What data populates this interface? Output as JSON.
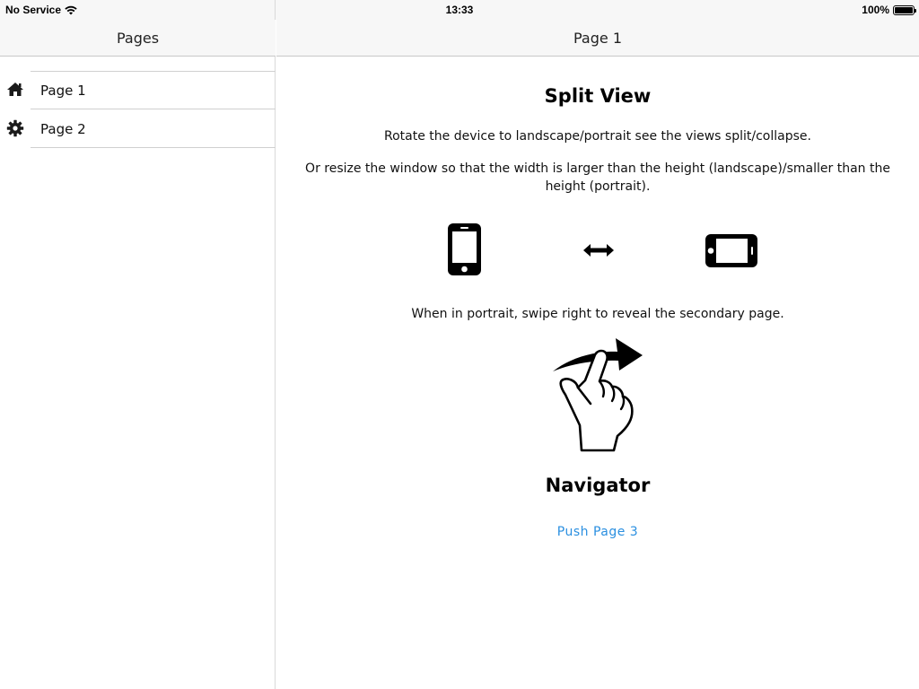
{
  "status_bar": {
    "carrier": "No Service",
    "time": "13:33",
    "battery": "100%",
    "battery_level": 1.0
  },
  "sidebar": {
    "title": "Pages",
    "items": [
      {
        "label": "Page 1",
        "icon": "home-icon"
      },
      {
        "label": "Page 2",
        "icon": "gear-icon"
      }
    ]
  },
  "main": {
    "title": "Page 1",
    "heading": "Split View",
    "paragraph_1": "Rotate the device to landscape/portrait see the views split/collapse.",
    "paragraph_2": "Or resize the window so that the width is larger than the height (landscape)/smaller than the height (portrait).",
    "paragraph_3": "When in portrait, swipe right to reveal the secondary page.",
    "icons": [
      "phone-portrait-icon",
      "double-arrow-icon",
      "phone-landscape-icon",
      "swipe-gesture-icon"
    ],
    "navigator_heading": "Navigator",
    "push_link": "Push Page 3",
    "link_color": "#2a8fe0"
  }
}
